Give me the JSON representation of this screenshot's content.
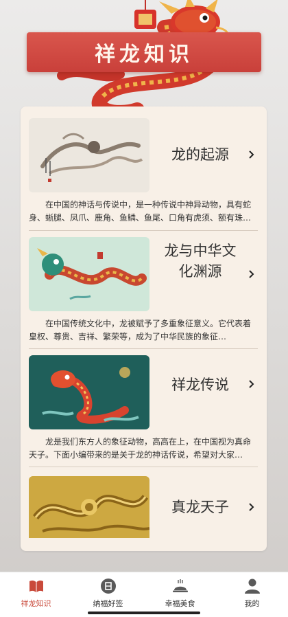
{
  "header": {
    "title": "祥龙知识"
  },
  "items": [
    {
      "title": "龙的起源",
      "desc": "在中国的神话与传说中，是一种传说中神异动物，具有蛇身、蜥腿、凤爪、鹿角、鱼鳞、鱼尾、口角有虎须、额有珠…"
    },
    {
      "title_line1": "龙与中华文",
      "title_line2": "化渊源",
      "desc": "在中国传统文化中，龙被赋予了多重象征意义。它代表着皇权、尊贵、吉祥、繁荣等，成为了中华民族的象征…"
    },
    {
      "title": "祥龙传说",
      "desc": "龙是我们东方人的象征动物，高高在上，在中国视为真命天子。下面小编带来的是关于龙的神话传说，希望对大家…"
    },
    {
      "title": "真龙天子"
    }
  ],
  "tabs": [
    {
      "label": "祥龙知识",
      "icon": "book-icon",
      "active": true
    },
    {
      "label": "纳福好签",
      "icon": "fortune-coin-icon"
    },
    {
      "label": "幸福美食",
      "icon": "dish-cover-icon"
    },
    {
      "label": "我的",
      "icon": "user-icon"
    }
  ],
  "colors": {
    "accent": "#c94a3b",
    "banner": "#d14a42",
    "panel": "#f8f0e7"
  }
}
